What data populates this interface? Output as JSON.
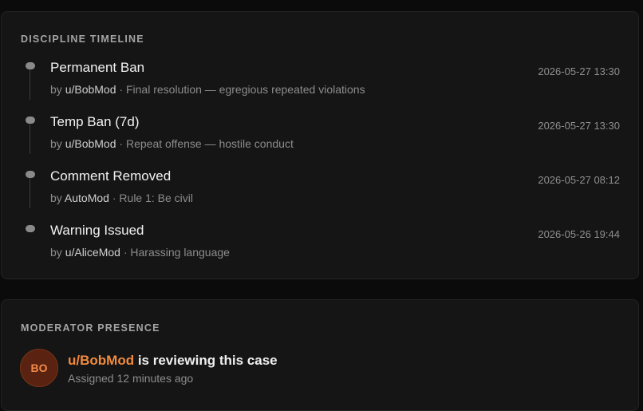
{
  "timeline": {
    "title": "DISCIPLINE TIMELINE",
    "items": [
      {
        "title": "Permanent Ban",
        "by": "by",
        "actor": "u/BobMod",
        "note": "Final resolution — egregious repeated violations",
        "time": "2026-05-27 13:30"
      },
      {
        "title": "Temp Ban (7d)",
        "by": "by",
        "actor": "u/BobMod",
        "note": "Repeat offense — hostile conduct",
        "time": "2026-05-27 13:30"
      },
      {
        "title": "Comment Removed",
        "by": "by",
        "actor": "AutoMod",
        "note": "Rule 1: Be civil",
        "time": "2026-05-27 08:12"
      },
      {
        "title": "Warning Issued",
        "by": "by",
        "actor": "u/AliceMod",
        "note": "Harassing language",
        "time": "2026-05-26 19:44"
      }
    ]
  },
  "presence": {
    "title": "MODERATOR PRESENCE",
    "avatar_initials": "BO",
    "user": "u/BobMod",
    "status_text": " is reviewing this case",
    "assigned": "Assigned 12 minutes ago"
  },
  "colors": {
    "background": "#0b0b0b",
    "panel": "#151515",
    "accent": "#f28a3d",
    "avatar_bg": "#5a2210"
  }
}
